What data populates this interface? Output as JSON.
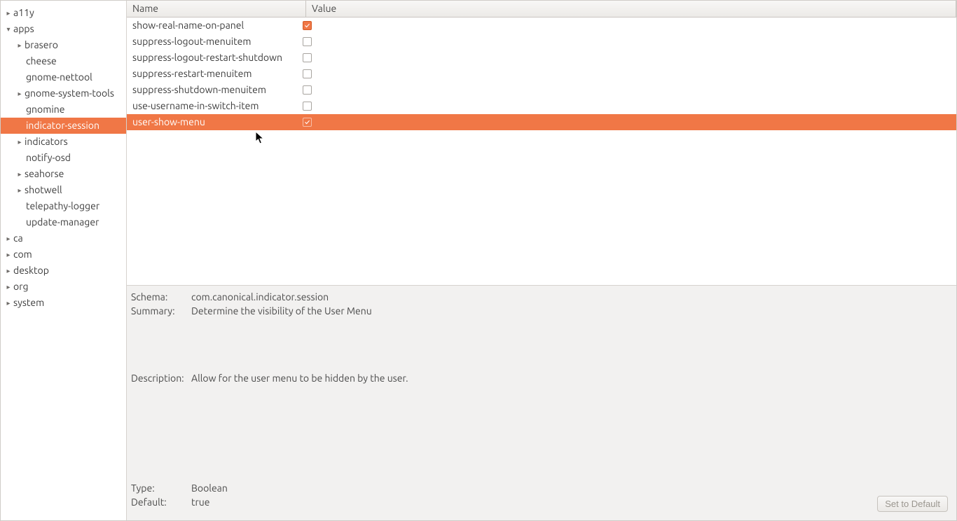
{
  "columns": {
    "name": "Name",
    "value": "Value"
  },
  "tree": [
    {
      "label": "a11y",
      "depth": 0,
      "arrow": "right"
    },
    {
      "label": "apps",
      "depth": 0,
      "arrow": "down"
    },
    {
      "label": "brasero",
      "depth": 1,
      "arrow": "right"
    },
    {
      "label": "cheese",
      "depth": 1,
      "arrow": "none"
    },
    {
      "label": "gnome-nettool",
      "depth": 1,
      "arrow": "none"
    },
    {
      "label": "gnome-system-tools",
      "depth": 1,
      "arrow": "right"
    },
    {
      "label": "gnomine",
      "depth": 1,
      "arrow": "none"
    },
    {
      "label": "indicator-session",
      "depth": 1,
      "arrow": "none",
      "selected": true
    },
    {
      "label": "indicators",
      "depth": 1,
      "arrow": "right"
    },
    {
      "label": "notify-osd",
      "depth": 1,
      "arrow": "none"
    },
    {
      "label": "seahorse",
      "depth": 1,
      "arrow": "right"
    },
    {
      "label": "shotwell",
      "depth": 1,
      "arrow": "right"
    },
    {
      "label": "telepathy-logger",
      "depth": 1,
      "arrow": "none"
    },
    {
      "label": "update-manager",
      "depth": 1,
      "arrow": "none"
    },
    {
      "label": "ca",
      "depth": 0,
      "arrow": "right"
    },
    {
      "label": "com",
      "depth": 0,
      "arrow": "right"
    },
    {
      "label": "desktop",
      "depth": 0,
      "arrow": "right"
    },
    {
      "label": "org",
      "depth": 0,
      "arrow": "right"
    },
    {
      "label": "system",
      "depth": 0,
      "arrow": "right"
    }
  ],
  "rows": [
    {
      "name": "show-real-name-on-panel",
      "checked": true
    },
    {
      "name": "suppress-logout-menuitem",
      "checked": false
    },
    {
      "name": "suppress-logout-restart-shutdown",
      "checked": false
    },
    {
      "name": "suppress-restart-menuitem",
      "checked": false
    },
    {
      "name": "suppress-shutdown-menuitem",
      "checked": false
    },
    {
      "name": "use-username-in-switch-item",
      "checked": false
    },
    {
      "name": "user-show-menu",
      "checked": true,
      "selected": true
    }
  ],
  "details": {
    "schema_label": "Schema:",
    "schema_value": "com.canonical.indicator.session",
    "summary_label": "Summary:",
    "summary_value": "Determine the visibility of the User Menu",
    "description_label": "Description:",
    "description_value": "Allow for the user menu to be hidden by the user.",
    "type_label": "Type:",
    "type_value": "Boolean",
    "default_label": "Default:",
    "default_value": "true"
  },
  "buttons": {
    "set_default": "Set to Default"
  }
}
